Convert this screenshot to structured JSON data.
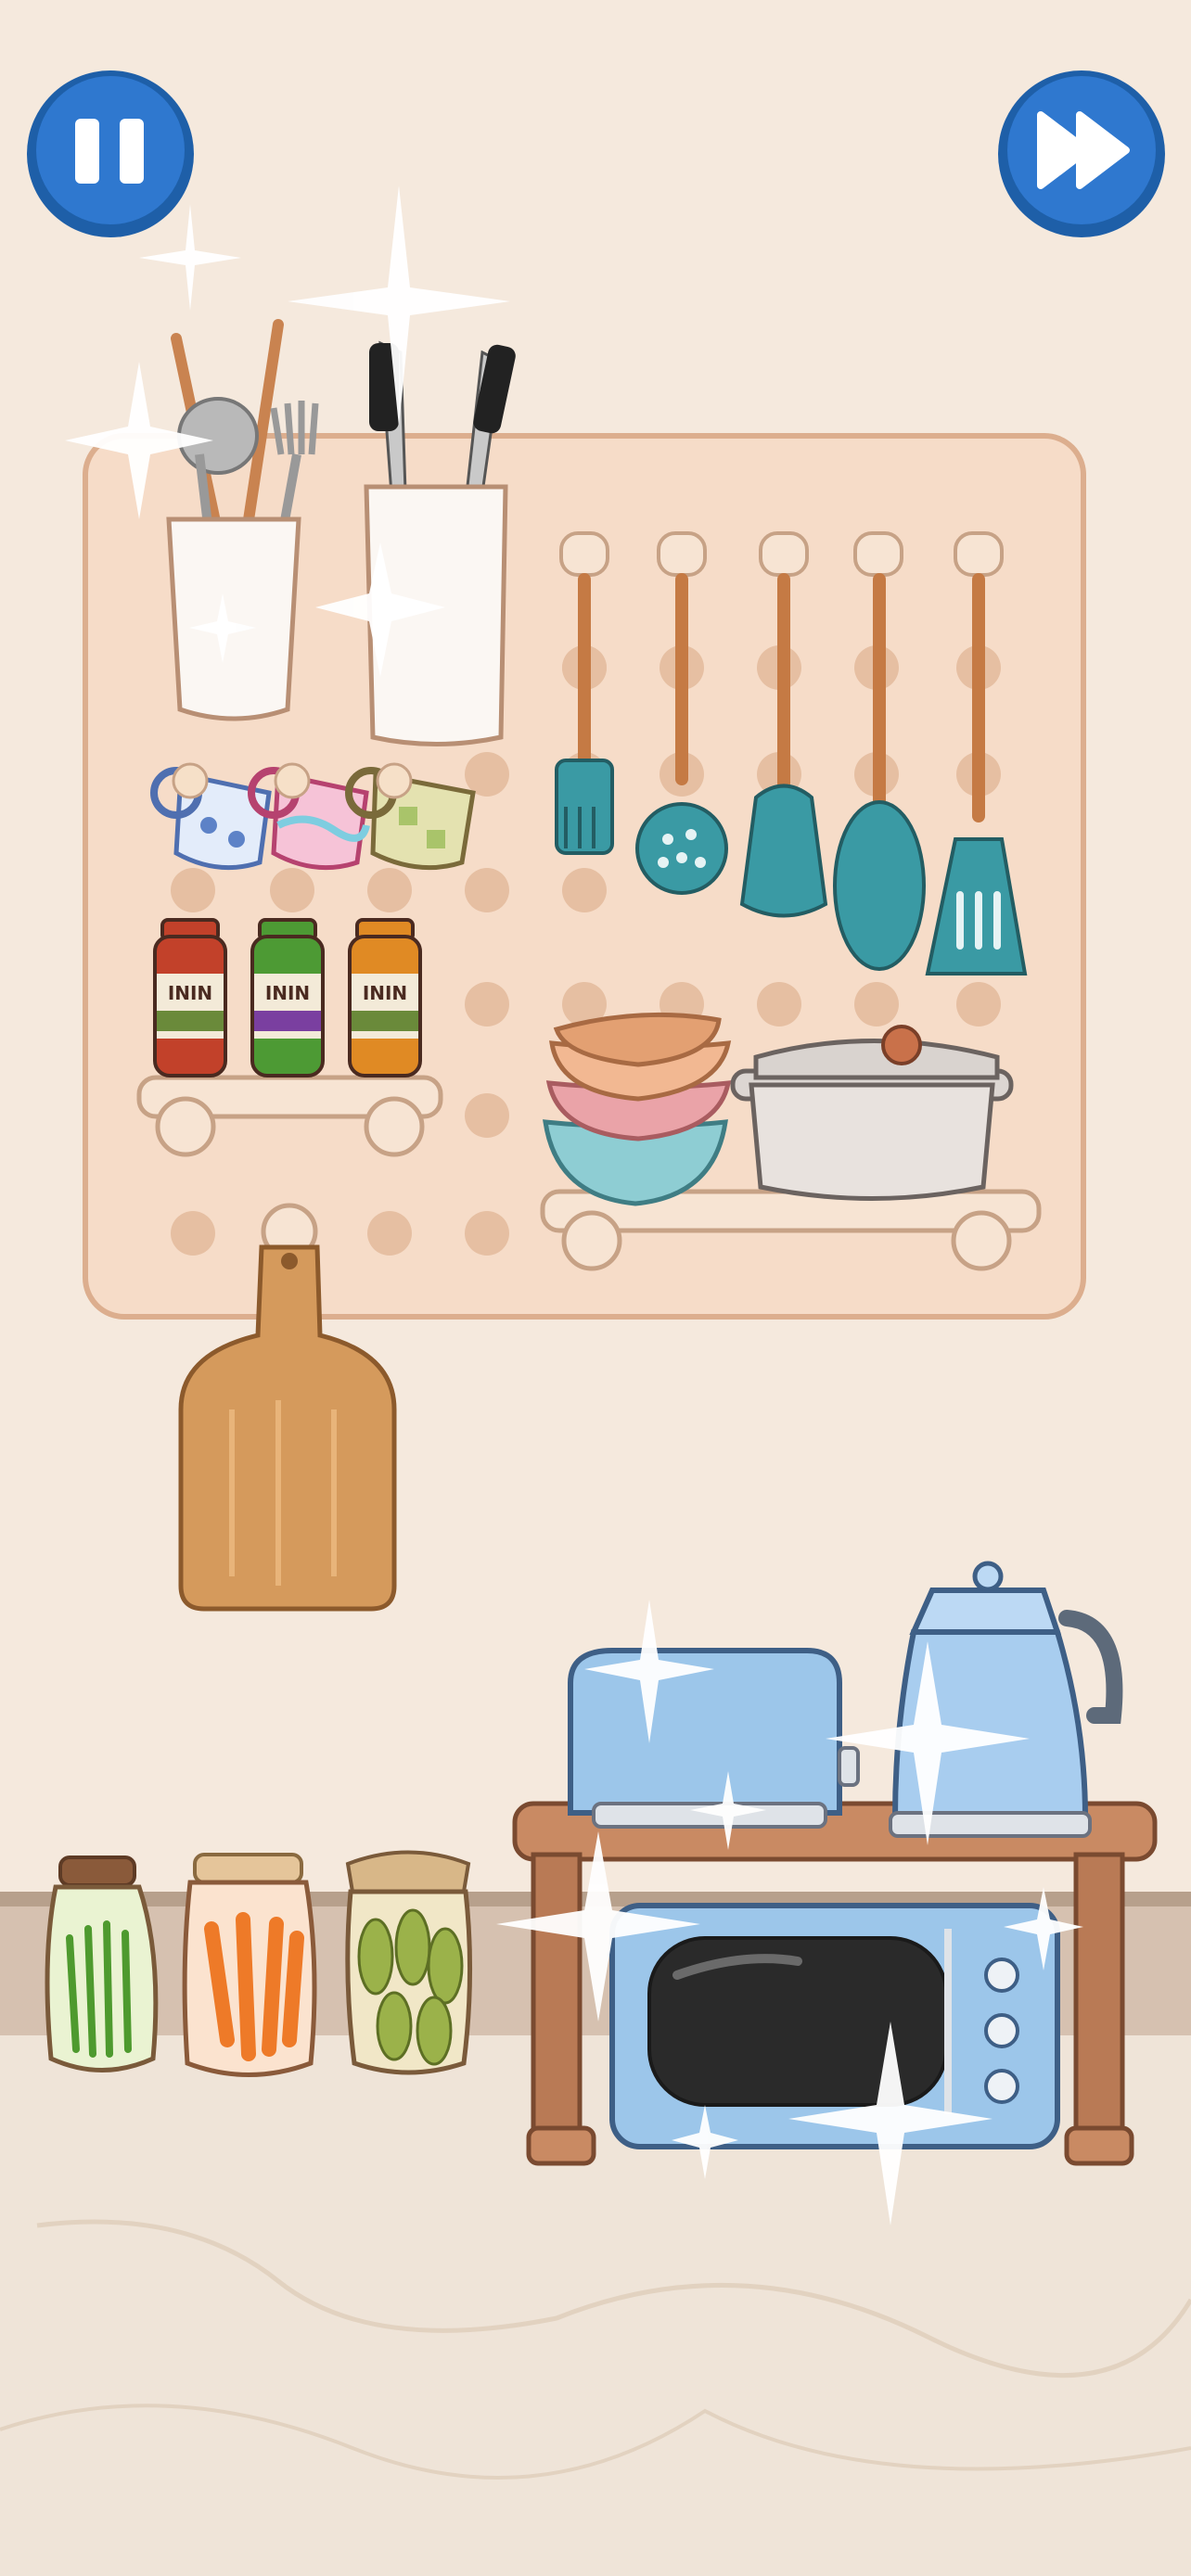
{
  "controls": {
    "pause_button": {
      "icon": "pause-icon",
      "color": "#2f78cf"
    },
    "skip_button": {
      "icon": "fast-forward-icon",
      "color": "#2f78cf"
    }
  },
  "pegboard": {
    "color": "#f6dcc8",
    "jars": [
      {
        "name": "jar-tomato",
        "label": "ININ",
        "color": "#c2412a"
      },
      {
        "name": "jar-lime",
        "label": "ININ",
        "color": "#4d9a34"
      },
      {
        "name": "jar-orange",
        "label": "ININ",
        "color": "#e08a24"
      }
    ],
    "utensils": [
      "brush",
      "skimmer",
      "turner",
      "spoon",
      "slotted-spatula"
    ],
    "mugs": [
      "blue-pattern-mug",
      "pink-wave-mug",
      "green-check-mug"
    ]
  },
  "counter": {
    "pickle_jars": [
      "green-beans-jar",
      "carrots-jar",
      "pickles-jar"
    ],
    "appliances": [
      "toaster",
      "kettle",
      "microwave"
    ],
    "appliance_color": "#9cc6ea",
    "table_color": "#c98a63"
  },
  "colors": {
    "wall": "#f5e9dd",
    "floor": "#efe3d6",
    "baseboard": "#d9c4b3",
    "teal": "#3a9aa4",
    "wood": "#d59a5c"
  }
}
